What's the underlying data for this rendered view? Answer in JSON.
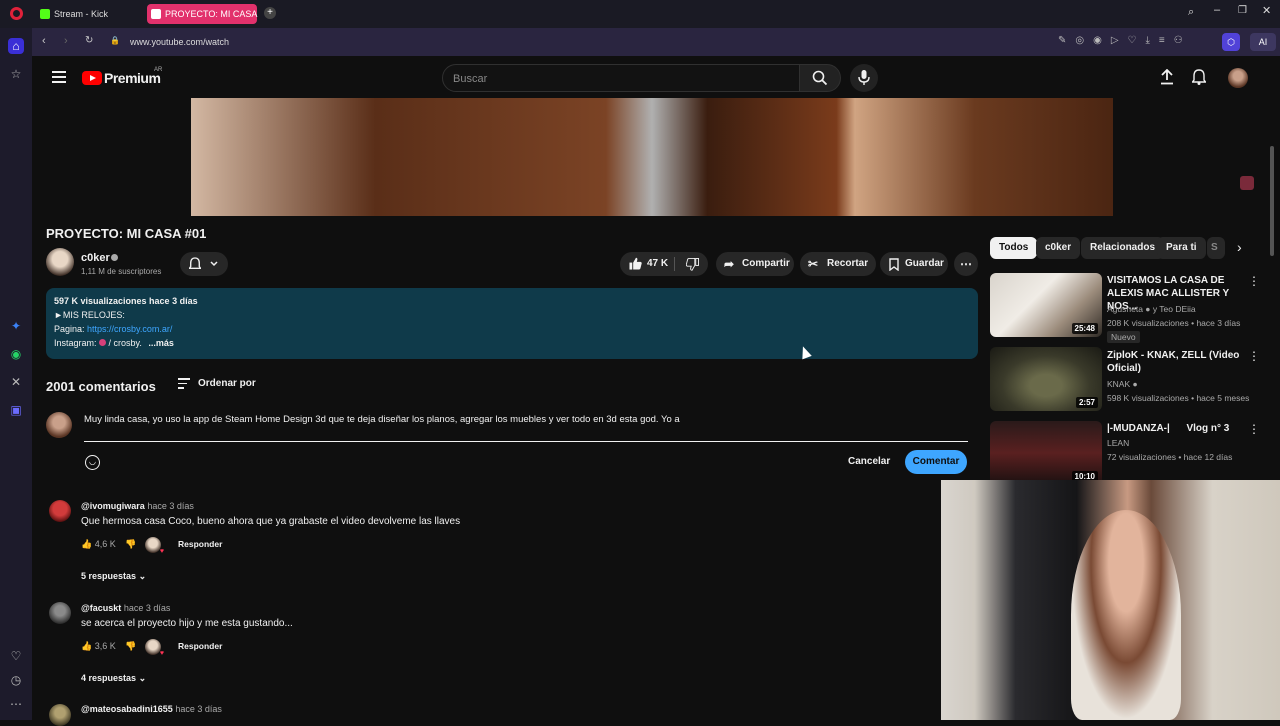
{
  "browser": {
    "tabs": [
      {
        "label": "Stream - Kick Dashboard",
        "active": false
      },
      {
        "label": "PROYECTO: MI CASA #01",
        "active": true
      }
    ],
    "url": "www.youtube.com/watch"
  },
  "header": {
    "logo": "Premium",
    "region": "AR",
    "search_placeholder": "Buscar"
  },
  "video": {
    "title": "PROYECTO: MI CASA #01",
    "channel": "c0ker",
    "subscribers": "1,11 M de suscriptores",
    "likes": "47 K",
    "share_label": "Compartir",
    "clip_label": "Recortar",
    "save_label": "Guardar"
  },
  "description": {
    "stats": "597 K visualizaciones  hace 3 días",
    "line1": "►MIS RELOJES:",
    "line2_label": "Pagina: ",
    "line2_link": "https://crosby.com.ar/",
    "line3_label": "Instagram: ",
    "line3_value": " / crosby.",
    "more": "...más"
  },
  "comments": {
    "count": "2001 comentarios",
    "sort_label": "Ordenar por",
    "draft": "Muy linda casa, yo uso la app de Steam Home Design 3d que te deja diseñar los planos, agregar los muebles y ver todo en 3d esta god. Yo a",
    "cancel_label": "Cancelar",
    "submit_label": "Comentar",
    "reply_label": "Responder",
    "items": [
      {
        "handle": "@ivomugiwara",
        "time": "hace 3 días",
        "text": "Que hermosa casa Coco, bueno ahora que ya grabaste el video devolveme las llaves",
        "likes": "4,6 K",
        "replies": "5 respuestas"
      },
      {
        "handle": "@facuskt",
        "time": "hace 3 días",
        "text": "se acerca el proyecto hijo y me esta gustando...",
        "likes": "3,6 K",
        "replies": "4 respuestas"
      },
      {
        "handle": "@mateosabadini1655",
        "time": "hace 3 días",
        "text": "",
        "likes": "",
        "replies": ""
      }
    ]
  },
  "chips": [
    "Todos",
    "c0ker",
    "Relacionados",
    "Para ti",
    "S"
  ],
  "related": [
    {
      "title": "VISITAMOS LA CASA DE ALEXIS MAC ALLISTER Y NOS...",
      "channel": "Agusneta",
      "collab": "y Teo DEiia",
      "meta": "208 K visualizaciones • hace 3 días",
      "badge": "Nuevo",
      "duration": "25:48"
    },
    {
      "title": "ZiploK - KNAK, ZELL (Video Oficial)",
      "channel": "KNAK",
      "collab": "",
      "meta": "598 K visualizaciones • hace 5 meses",
      "badge": "",
      "duration": "2:57"
    },
    {
      "title": "|-MUDANZA-|      Vlog n° 3",
      "channel": "LEAN",
      "collab": "",
      "meta": "72 visualizaciones • hace 12 días",
      "badge": "",
      "duration": "10:10"
    }
  ],
  "colors": {
    "accent_blue": "#3ea6ff",
    "yt_red": "#ff0000",
    "description_bg": "#0f3a4a"
  }
}
